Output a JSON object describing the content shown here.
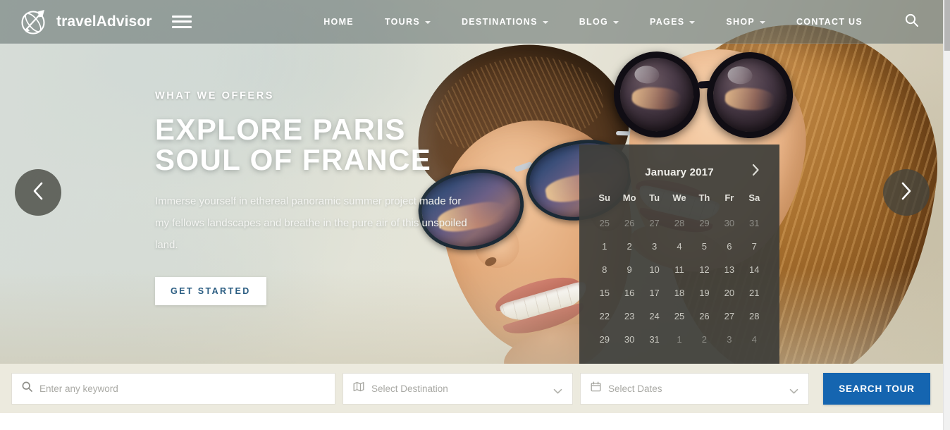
{
  "site": {
    "logo_text": "travelAdvisor",
    "logo_icon": "globe-plane-icon",
    "menu_icon": "hamburger-menu-icon",
    "search_icon": "search-icon"
  },
  "nav": {
    "items": [
      {
        "label": "HOME",
        "has_dropdown": false
      },
      {
        "label": "TOURS",
        "has_dropdown": true
      },
      {
        "label": "DESTINATIONS",
        "has_dropdown": true
      },
      {
        "label": "BLOG",
        "has_dropdown": true
      },
      {
        "label": "PAGES",
        "has_dropdown": true
      },
      {
        "label": "SHOP",
        "has_dropdown": true
      },
      {
        "label": "CONTACT US",
        "has_dropdown": false
      }
    ]
  },
  "hero": {
    "eyebrow": "WHAT WE OFFERS",
    "title_line1": "EXPLORE PARIS",
    "title_line2": "SOUL OF FRANCE",
    "description": "Immerse yourself in ethereal panoramic summer project made for my fellows landscapes and breathe in the pure air of this unspoiled land.",
    "cta_label": "GET STARTED",
    "prev_icon": "chevron-left-icon",
    "next_icon": "chevron-right-icon"
  },
  "calendar": {
    "title": "January 2017",
    "next_icon": "chevron-right-icon",
    "day_names": [
      "Su",
      "Mo",
      "Tu",
      "We",
      "Th",
      "Fr",
      "Sa"
    ],
    "weeks": [
      [
        {
          "d": "25",
          "muted": true
        },
        {
          "d": "26",
          "muted": true
        },
        {
          "d": "27",
          "muted": true
        },
        {
          "d": "28",
          "muted": true
        },
        {
          "d": "29",
          "muted": true
        },
        {
          "d": "30",
          "muted": true
        },
        {
          "d": "31",
          "muted": true
        }
      ],
      [
        {
          "d": "1",
          "muted": false
        },
        {
          "d": "2",
          "muted": false
        },
        {
          "d": "3",
          "muted": false
        },
        {
          "d": "4",
          "muted": false
        },
        {
          "d": "5",
          "muted": false
        },
        {
          "d": "6",
          "muted": false
        },
        {
          "d": "7",
          "muted": false
        }
      ],
      [
        {
          "d": "8",
          "muted": false
        },
        {
          "d": "9",
          "muted": false
        },
        {
          "d": "10",
          "muted": false
        },
        {
          "d": "11",
          "muted": false
        },
        {
          "d": "12",
          "muted": false
        },
        {
          "d": "13",
          "muted": false
        },
        {
          "d": "14",
          "muted": false
        }
      ],
      [
        {
          "d": "15",
          "muted": false
        },
        {
          "d": "16",
          "muted": false
        },
        {
          "d": "17",
          "muted": false
        },
        {
          "d": "18",
          "muted": false
        },
        {
          "d": "19",
          "muted": false
        },
        {
          "d": "20",
          "muted": false
        },
        {
          "d": "21",
          "muted": false
        }
      ],
      [
        {
          "d": "22",
          "muted": false
        },
        {
          "d": "23",
          "muted": false
        },
        {
          "d": "24",
          "muted": false
        },
        {
          "d": "25",
          "muted": false
        },
        {
          "d": "26",
          "muted": false
        },
        {
          "d": "27",
          "muted": false
        },
        {
          "d": "28",
          "muted": false
        }
      ],
      [
        {
          "d": "29",
          "muted": false
        },
        {
          "d": "30",
          "muted": false
        },
        {
          "d": "31",
          "muted": false
        },
        {
          "d": "1",
          "muted": true
        },
        {
          "d": "2",
          "muted": true
        },
        {
          "d": "3",
          "muted": true
        },
        {
          "d": "4",
          "muted": true
        }
      ]
    ]
  },
  "search": {
    "keyword_placeholder": "Enter any keyword",
    "keyword_icon": "search-icon",
    "destination_placeholder": "Select Destination",
    "destination_icon": "map-icon",
    "dates_placeholder": "Select Dates",
    "dates_icon": "calendar-icon",
    "dropdown_icon": "chevron-down-icon",
    "submit_label": "SEARCH TOUR"
  },
  "colors": {
    "accent_blue": "#1565b0",
    "cta_text": "#2b5d82",
    "header_overlay": "rgba(95,108,105,0.55)",
    "calendar_panel": "rgba(62,62,58,0.93)",
    "searchbar_bg": "#eceade",
    "arrow_bg": "rgba(66,68,62,0.78)"
  }
}
